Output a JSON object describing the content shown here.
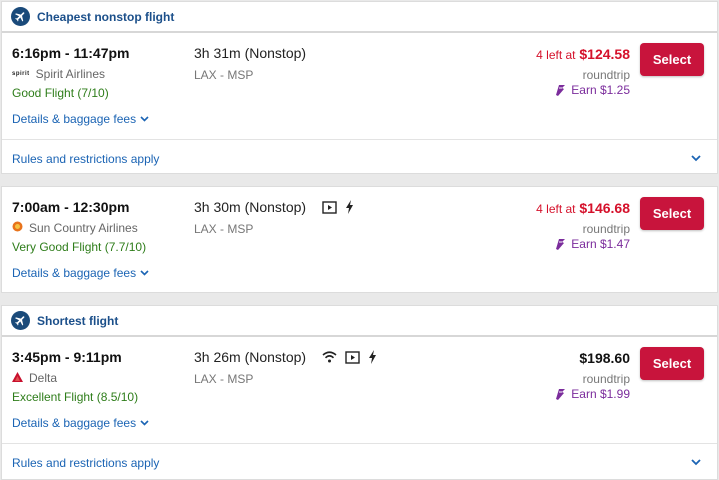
{
  "sections": {
    "cheapest": {
      "title": "Cheapest nonstop flight"
    },
    "shortest": {
      "title": "Shortest flight"
    }
  },
  "flights": [
    {
      "times": "6:16pm - 11:47pm",
      "airline": "Spirit Airlines",
      "logo_text": "spirit",
      "rating": "Good Flight (7/10)",
      "details": "Details & baggage fees",
      "duration": "3h 31m (Nonstop)",
      "route": "LAX - MSP",
      "seats_left": "4 left at",
      "price": "$124.58",
      "trip": "roundtrip",
      "earn": "Earn $1.25",
      "select": "Select",
      "amenities": []
    },
    {
      "times": "7:00am - 12:30pm",
      "airline": "Sun Country Airlines",
      "rating": "Very Good Flight (7.7/10)",
      "details": "Details & baggage fees",
      "duration": "3h 30m (Nonstop)",
      "route": "LAX - MSP",
      "seats_left": "4 left at",
      "price": "$146.68",
      "trip": "roundtrip",
      "earn": "Earn $1.47",
      "select": "Select",
      "amenities": [
        "video-icon",
        "power-icon"
      ]
    },
    {
      "times": "3:45pm - 9:11pm",
      "airline": "Delta",
      "rating": "Excellent Flight (8.5/10)",
      "details": "Details & baggage fees",
      "duration": "3h 26m (Nonstop)",
      "route": "LAX - MSP",
      "price": "$198.60",
      "trip": "roundtrip",
      "earn": "Earn $1.99",
      "select": "Select",
      "amenities": [
        "wifi-icon",
        "video-icon",
        "power-icon"
      ]
    }
  ],
  "rules_text": "Rules and restrictions apply",
  "colors": {
    "header_title": "#1b4f8a",
    "price_alert": "#d5112b",
    "select_button": "#c8143c",
    "rating_green": "#2e7d1a",
    "link_blue": "#1b64b4",
    "earn_purple": "#7b2c9c"
  }
}
